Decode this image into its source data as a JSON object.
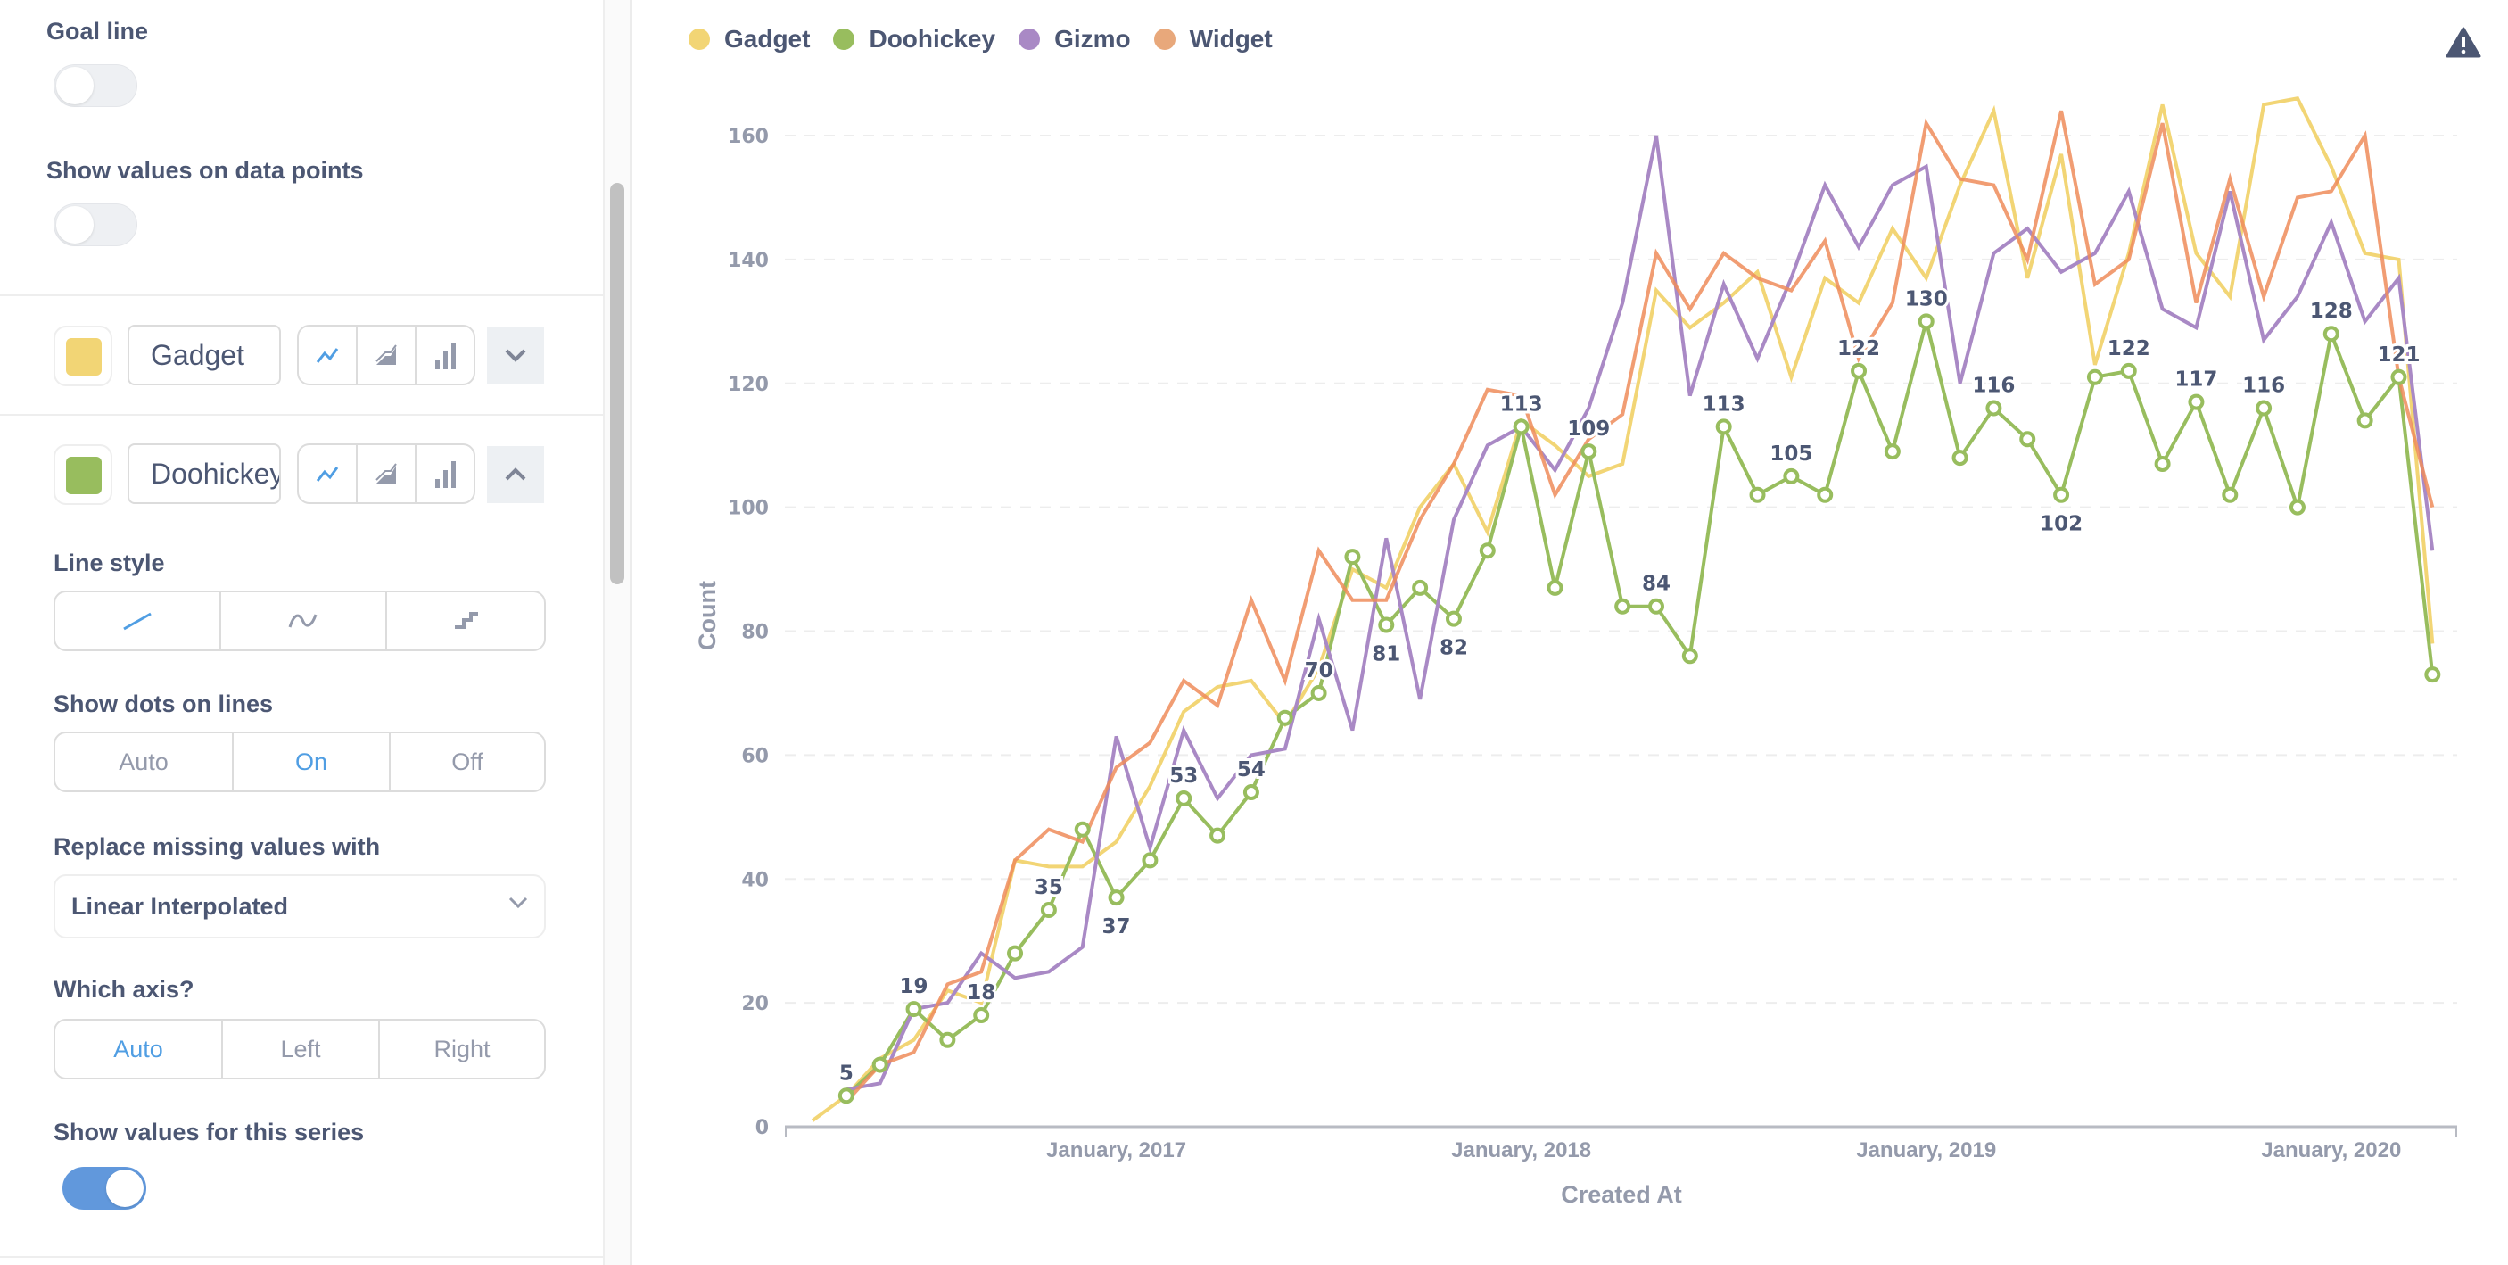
{
  "sidebar": {
    "goal_line": {
      "label": "Goal line",
      "enabled": false
    },
    "show_values": {
      "label": "Show values on data points",
      "enabled": false
    },
    "series": [
      {
        "name": "Gadget",
        "color": "#f2d575",
        "display": "line",
        "expanded": false
      },
      {
        "name": "Doohickey",
        "color": "#98bd5e",
        "display": "line",
        "expanded": true
      }
    ],
    "series_settings": {
      "line_style": {
        "label": "Line style",
        "options": [
          "straight-line-icon",
          "curved-line-icon",
          "step-line-icon"
        ],
        "selected": 0
      },
      "show_dots": {
        "label": "Show dots on lines",
        "options": [
          "Auto",
          "On",
          "Off"
        ],
        "selected": 1
      },
      "missing_values": {
        "label": "Replace missing values with",
        "value": "Linear Interpolated"
      },
      "which_axis": {
        "label": "Which axis?",
        "options": [
          "Auto",
          "Left",
          "Right"
        ],
        "selected": 0
      },
      "show_series_values": {
        "label": "Show values for this series",
        "enabled": true
      }
    }
  },
  "colors": {
    "accent": "#509ee3",
    "toggle_on": "#6198dc",
    "text": "#4c5773",
    "muted": "#949aab"
  },
  "warning_icon": "warning-triangle-icon",
  "chart_data": {
    "type": "line",
    "title": "",
    "xlabel": "Created At",
    "ylabel": "Count",
    "ylim": [
      0,
      160
    ],
    "yticks": [
      0,
      20,
      40,
      60,
      80,
      100,
      120,
      140,
      160
    ],
    "grid": true,
    "legend": "top-left",
    "x_start": "2016-04",
    "xtick_labels": [
      {
        "label": "January, 2017",
        "month_index": 9
      },
      {
        "label": "January, 2018",
        "month_index": 21
      },
      {
        "label": "January, 2019",
        "month_index": 33
      },
      {
        "label": "January, 2020",
        "month_index": 45
      }
    ],
    "x": [
      "2016-04",
      "2016-05",
      "2016-06",
      "2016-07",
      "2016-08",
      "2016-09",
      "2016-10",
      "2016-11",
      "2016-12",
      "2017-01",
      "2017-02",
      "2017-03",
      "2017-04",
      "2017-05",
      "2017-06",
      "2017-07",
      "2017-08",
      "2017-09",
      "2017-10",
      "2017-11",
      "2017-12",
      "2018-01",
      "2018-02",
      "2018-03",
      "2018-04",
      "2018-05",
      "2018-06",
      "2018-07",
      "2018-08",
      "2018-09",
      "2018-10",
      "2018-11",
      "2018-12",
      "2019-01",
      "2019-02",
      "2019-03",
      "2019-04",
      "2019-05",
      "2019-06",
      "2019-07",
      "2019-08",
      "2019-09",
      "2019-10",
      "2019-11",
      "2019-12",
      "2020-01",
      "2020-02",
      "2020-03",
      "2020-04"
    ],
    "series": [
      {
        "name": "Gadget",
        "color": "#f2d575",
        "dots": false,
        "values": [
          1,
          5,
          11,
          14,
          22,
          20,
          43,
          42,
          42,
          46,
          55,
          67,
          71,
          72,
          65,
          74,
          90,
          87,
          100,
          107,
          96,
          114,
          110,
          105,
          107,
          135,
          129,
          133,
          138,
          121,
          137,
          133,
          145,
          137,
          152,
          164,
          137,
          157,
          123,
          141,
          165,
          141,
          134,
          165,
          166,
          155,
          141,
          140,
          78
        ]
      },
      {
        "name": "Doohickey",
        "color": "#98bd5e",
        "dots": true,
        "values": [
          null,
          5,
          10,
          19,
          14,
          18,
          28,
          35,
          48,
          37,
          43,
          53,
          47,
          54,
          66,
          70,
          92,
          81,
          87,
          82,
          93,
          113,
          87,
          109,
          84,
          84,
          76,
          113,
          102,
          105,
          102,
          122,
          109,
          130,
          108,
          116,
          111,
          102,
          121,
          122,
          107,
          117,
          102,
          116,
          100,
          128,
          114,
          121,
          73
        ],
        "labeled_values": {
          "1": 5,
          "3": 19,
          "5": 18,
          "7": 35,
          "9": 37,
          "11": 53,
          "13": 54,
          "15": 70,
          "17": 81,
          "19": 82,
          "21": 113,
          "23": 109,
          "25": 84,
          "27": 113,
          "29": 105,
          "31": 122,
          "33": 130,
          "35": 116,
          "37": 102,
          "39": 122,
          "41": 117,
          "43": 116,
          "45": 128,
          "47": 121
        }
      },
      {
        "name": "Gizmo",
        "color": "#a989c5",
        "dots": false,
        "values": [
          null,
          6,
          7,
          19,
          20,
          28,
          24,
          25,
          29,
          63,
          45,
          64,
          53,
          60,
          61,
          82,
          64,
          95,
          69,
          98,
          110,
          113,
          106,
          116,
          133,
          160,
          118,
          136,
          124,
          137,
          152,
          142,
          152,
          155,
          120,
          141,
          145,
          138,
          141,
          151,
          132,
          129,
          151,
          127,
          134,
          146,
          130,
          137,
          93
        ]
      },
      {
        "name": "Widget",
        "color": "#ef8c5a",
        "dots": false,
        "values": [
          null,
          4,
          10,
          12,
          23,
          25,
          43,
          48,
          46,
          58,
          62,
          72,
          68,
          85,
          72,
          93,
          85,
          85,
          98,
          107,
          119,
          118,
          102,
          111,
          115,
          141,
          132,
          141,
          137,
          135,
          143,
          124,
          133,
          162,
          153,
          152,
          140,
          164,
          136,
          140,
          162,
          133,
          153,
          134,
          150,
          151,
          160,
          121,
          100
        ]
      }
    ]
  }
}
